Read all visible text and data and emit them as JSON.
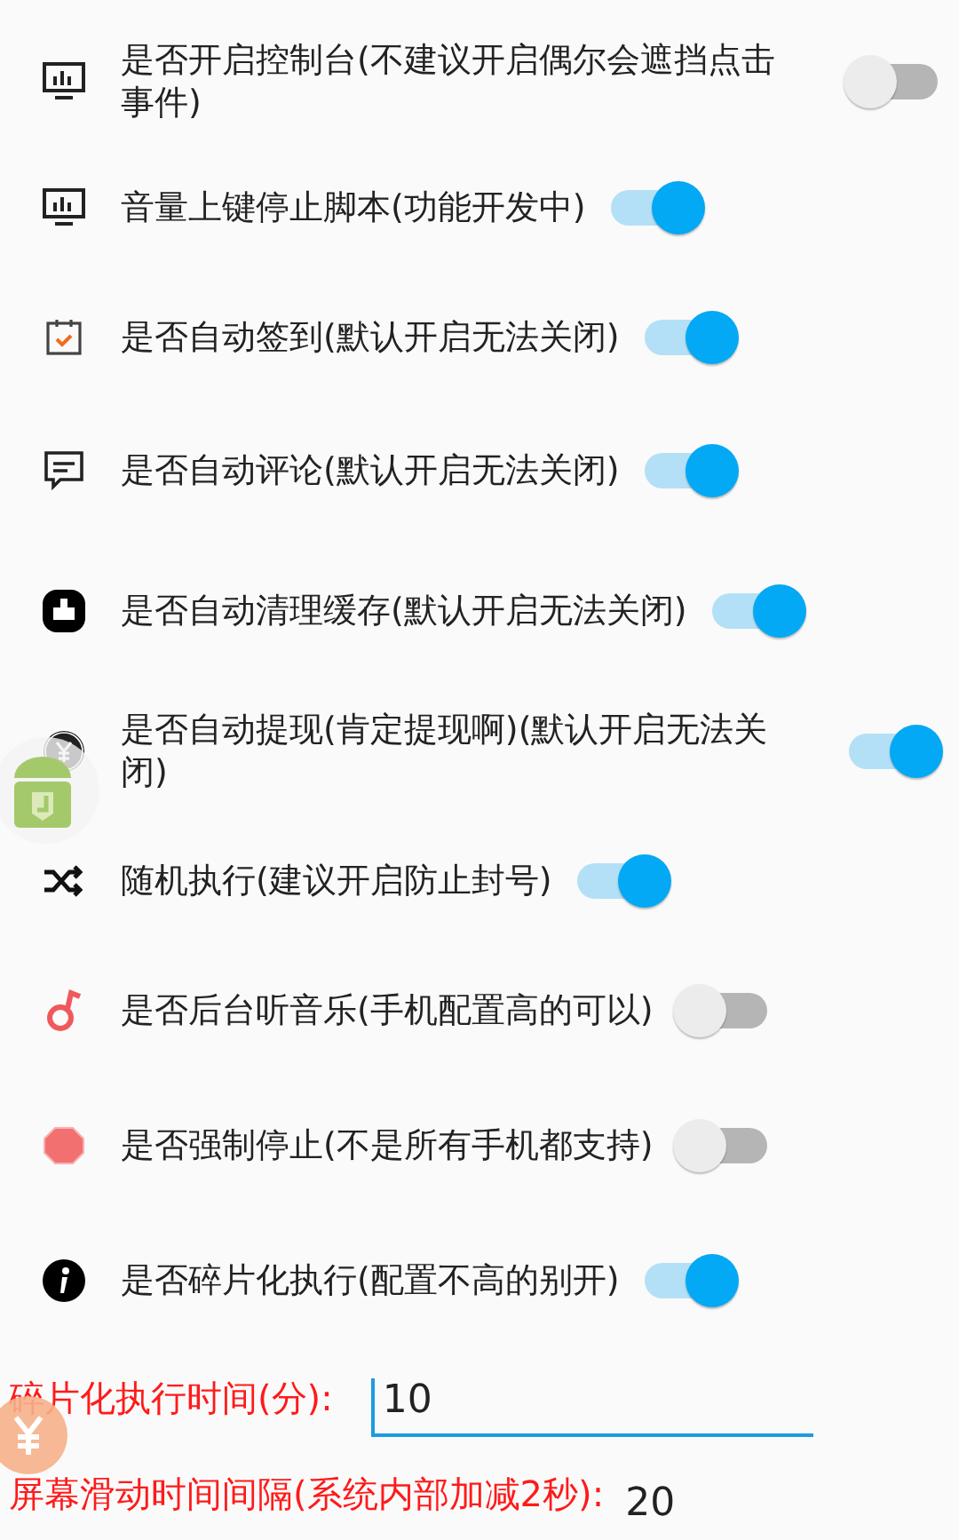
{
  "settings": [
    {
      "label": "是否开启控制台(不建议开启偶尔会遮挡点击事件)",
      "on": false
    },
    {
      "label": "音量上键停止脚本(功能开发中)",
      "on": true
    },
    {
      "label": "是否自动签到(默认开启无法关闭)",
      "on": true
    },
    {
      "label": "是否自动评论(默认开启无法关闭)",
      "on": true
    },
    {
      "label": "是否自动清理缓存(默认开启无法关闭)",
      "on": true
    },
    {
      "label": "是否自动提现(肯定提现啊)(默认开启无法关闭)",
      "on": true
    },
    {
      "label": "随机执行(建议开启防止封号)",
      "on": true
    },
    {
      "label": "是否后台听音乐(手机配置高的可以)",
      "on": false
    },
    {
      "label": "是否强制停止(不是所有手机都支持)",
      "on": false
    },
    {
      "label": "是否碎片化执行(配置不高的别开)",
      "on": true
    }
  ],
  "fields": [
    {
      "label": "碎片化执行时间(分):",
      "value": "10",
      "kind": "underlined"
    },
    {
      "label": "屏幕滑动时间间隔(系统内部加减2秒):",
      "value": "20",
      "kind": "plain"
    }
  ]
}
